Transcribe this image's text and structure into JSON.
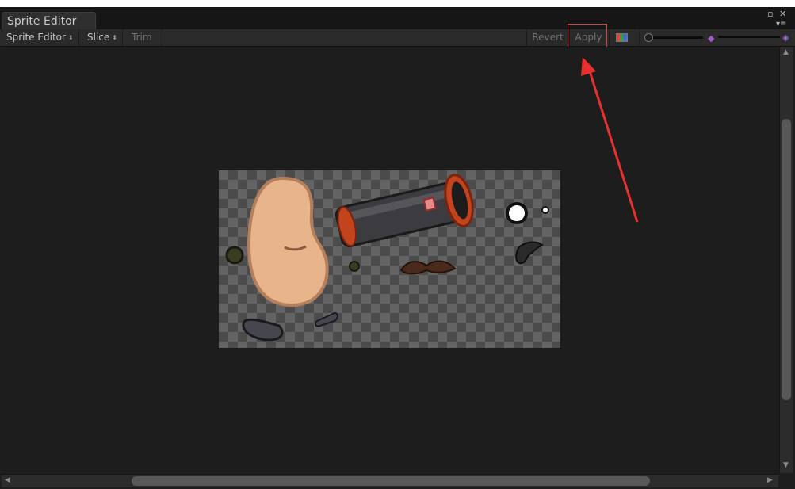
{
  "window": {
    "tab_title": "Sprite Editor",
    "maximize_icon": "▫",
    "close_icon": "✕",
    "menu_icon": "▾≡"
  },
  "toolbar": {
    "mode_label": "Sprite Editor",
    "slice_label": "Slice",
    "trim_label": "Trim",
    "revert_label": "Revert",
    "apply_label": "Apply",
    "dropdown_arrows": "⬍"
  },
  "annotation": {
    "highlight_color": "#e23a3a"
  },
  "scrollbars": {
    "left_arrow": "◀",
    "right_arrow": "▶",
    "up_arrow": "▲",
    "down_arrow": "▼"
  },
  "colors": {
    "background": "#1e1e1e",
    "checker_light": "#636363",
    "checker_dark": "#4b4b4b",
    "bean_skin": "#e8b48c",
    "cylinder_body": "#3c3c40",
    "cylinder_rim": "#c2431c"
  }
}
